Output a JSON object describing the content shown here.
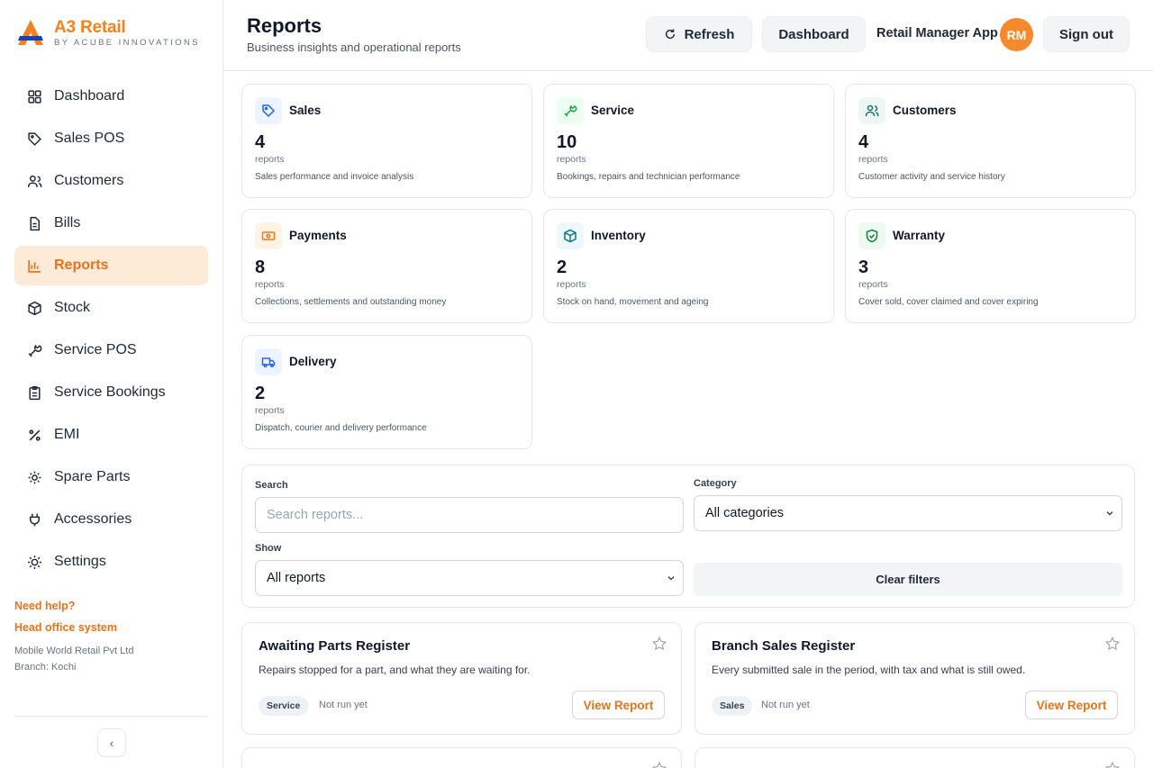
{
  "brand": {
    "name": "A3 Retail",
    "tagline": "BY ACUBE INNOVATIONS",
    "accent": "#f58220"
  },
  "sidebar": {
    "items": [
      {
        "label": "Dashboard",
        "icon": "grid-icon"
      },
      {
        "label": "Sales POS",
        "icon": "tag-icon"
      },
      {
        "label": "Customers",
        "icon": "users-icon"
      },
      {
        "label": "Bills",
        "icon": "file-icon"
      },
      {
        "label": "Reports",
        "icon": "bar-chart-icon",
        "active": true
      },
      {
        "label": "Stock",
        "icon": "box-icon"
      },
      {
        "label": "Service POS",
        "icon": "wrench-icon"
      },
      {
        "label": "Service Bookings",
        "icon": "clipboard-icon"
      },
      {
        "label": "EMI",
        "icon": "percent-icon"
      },
      {
        "label": "Spare Parts",
        "icon": "gear-part-icon"
      },
      {
        "label": "Accessories",
        "icon": "plug-icon"
      },
      {
        "label": "Settings",
        "icon": "sun-settings-icon"
      }
    ],
    "help_label": "Need help?",
    "head_office_label": "Head office system",
    "org_name": "Mobile World Retail Pvt Ltd",
    "branch": "Branch: Kochi"
  },
  "header": {
    "title": "Reports",
    "subtitle": "Business insights and operational reports",
    "refresh_label": "Refresh",
    "dashboard_label": "Dashboard",
    "app_name": "Retail Manager App",
    "avatar_initials": "RM",
    "signout_label": "Sign out"
  },
  "categories": [
    {
      "name": "Sales",
      "count": "4",
      "unit": "reports",
      "desc": "Sales performance and invoice analysis",
      "color": "#2563eb",
      "bg": "#eef4ff",
      "icon": "tag-icon"
    },
    {
      "name": "Service",
      "count": "10",
      "unit": "reports",
      "desc": "Bookings, repairs and technician performance",
      "color": "#16a34a",
      "bg": "#ecfdf3",
      "icon": "wrench-icon"
    },
    {
      "name": "Customers",
      "count": "4",
      "unit": "reports",
      "desc": "Customer activity and service history",
      "color": "#0f766e",
      "bg": "#eef6f6",
      "icon": "users-icon"
    },
    {
      "name": "Payments",
      "count": "8",
      "unit": "reports",
      "desc": "Collections, settlements and outstanding money",
      "color": "#ea7a1a",
      "bg": "#fff3e6",
      "icon": "cash-icon"
    },
    {
      "name": "Inventory",
      "count": "2",
      "unit": "reports",
      "desc": "Stock on hand, movement and ageing",
      "color": "#0e7490",
      "bg": "#ecf8fb",
      "icon": "box-icon"
    },
    {
      "name": "Warranty",
      "count": "3",
      "unit": "reports",
      "desc": "Cover sold, cover claimed and cover expiring",
      "color": "#15803d",
      "bg": "#edfaf1",
      "icon": "shield-check-icon"
    },
    {
      "name": "Delivery",
      "count": "2",
      "unit": "reports",
      "desc": "Dispatch, courier and delivery performance",
      "color": "#2563eb",
      "bg": "#eef4ff",
      "icon": "truck-icon"
    }
  ],
  "filters": {
    "search_label": "Search",
    "search_placeholder": "Search reports...",
    "category_label": "Category",
    "category_value": "All categories",
    "show_label": "Show",
    "show_value": "All reports",
    "clear_label": "Clear filters"
  },
  "reports": [
    {
      "title": "Awaiting Parts Register",
      "desc": "Repairs stopped for a part, and what they are waiting for.",
      "tag": "Service",
      "status": "Not run yet",
      "button": "View Report"
    },
    {
      "title": "Branch Sales Register",
      "desc": "Every submitted sale in the period, with tax and what is still owed.",
      "tag": "Sales",
      "status": "Not run yet",
      "button": "View Report"
    }
  ]
}
